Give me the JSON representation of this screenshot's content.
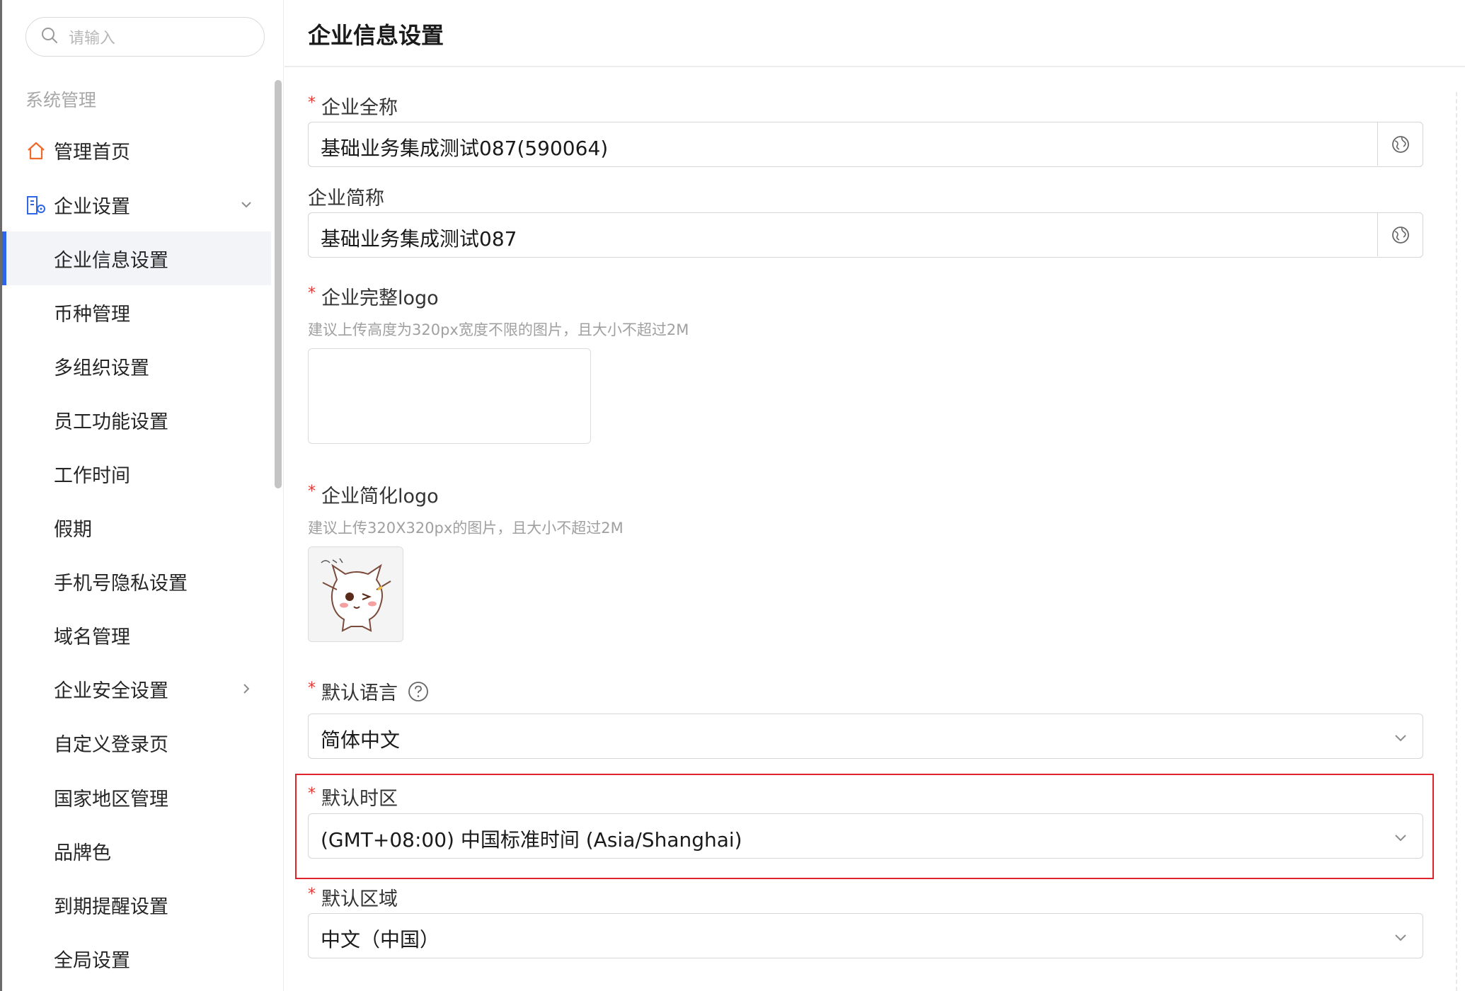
{
  "sidebar": {
    "search_placeholder": "请输入",
    "section_title": "系统管理",
    "items": [
      {
        "label": "管理首页"
      },
      {
        "label": "企业设置"
      },
      {
        "label": "企业信息设置"
      },
      {
        "label": "币种管理"
      },
      {
        "label": "多组织设置"
      },
      {
        "label": "员工功能设置"
      },
      {
        "label": "工作时间"
      },
      {
        "label": "假期"
      },
      {
        "label": "手机号隐私设置"
      },
      {
        "label": "域名管理"
      },
      {
        "label": "企业安全设置"
      },
      {
        "label": "自定义登录页"
      },
      {
        "label": "国家地区管理"
      },
      {
        "label": "品牌色"
      },
      {
        "label": "到期提醒设置"
      },
      {
        "label": "全局设置"
      }
    ],
    "active_item": "企业信息设置"
  },
  "main": {
    "title": "企业信息设置",
    "fields": {
      "full_name": {
        "label": "企业全称",
        "value": "基础业务集成测试087(590064)",
        "required": true
      },
      "short_name": {
        "label": "企业简称",
        "value": "基础业务集成测试087",
        "required": false
      },
      "full_logo": {
        "label": "企业完整logo",
        "hint": "建议上传高度为320px宽度不限的图片，且大小不超过2M",
        "required": true
      },
      "simple_logo": {
        "label": "企业简化logo",
        "hint": "建议上传320X320px的图片，且大小不超过2M",
        "required": true
      },
      "language": {
        "label": "默认语言",
        "value": "简体中文",
        "required": true
      },
      "timezone": {
        "label": "默认时区",
        "value": "(GMT+08:00) 中国标准时间 (Asia/Shanghai)",
        "required": true
      },
      "region": {
        "label": "默认区域",
        "value": "中文（中国）",
        "required": true
      }
    },
    "required_mark": "*"
  },
  "colors": {
    "accent": "#2f66e8",
    "required": "#e53935",
    "highlight_border": "#e0242c",
    "home_icon": "#f06a2a"
  },
  "icons": {
    "search": "search-icon",
    "home": "home-icon",
    "settings": "enterprise-settings-icon",
    "chevron_down": "chevron-down-icon",
    "chevron_right": "chevron-right-icon",
    "globe": "globe-icon",
    "help": "help-circle-icon"
  }
}
